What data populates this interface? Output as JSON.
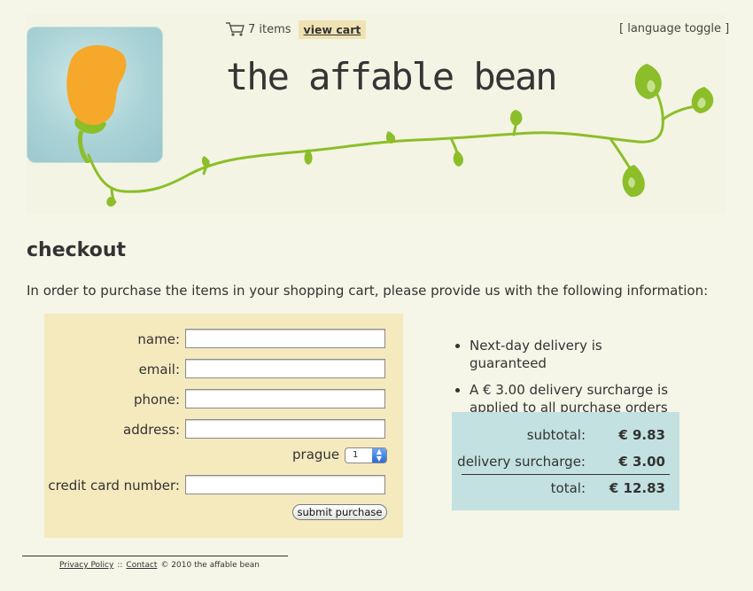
{
  "header": {
    "site_title": "the affable bean",
    "cart": {
      "item_count": "7 items",
      "view_cart_label": "view cart"
    },
    "language_toggle": "[ language toggle ]"
  },
  "checkout": {
    "heading": "checkout",
    "intro": "In order to purchase the items in your shopping cart, please provide us with the following information:",
    "form": {
      "name_label": "name:",
      "email_label": "email:",
      "phone_label": "phone:",
      "address_label": "address:",
      "city_label": "prague",
      "city_select_value": "1",
      "credit_card_label": "credit card number:",
      "submit_label": "submit purchase"
    },
    "info": [
      "Next-day delivery is guaranteed",
      "A € 3.00 delivery surcharge is applied to all purchase orders"
    ],
    "totals": {
      "subtotal_label": "subtotal:",
      "subtotal_value": "€ 9.83",
      "surcharge_label": "delivery surcharge:",
      "surcharge_value": "€ 3.00",
      "total_label": "total:",
      "total_value": "€ 12.83"
    }
  },
  "footer": {
    "privacy_policy": "Privacy Policy",
    "separator": "::",
    "contact": "Contact",
    "copyright": "©  2010 the affable bean"
  },
  "colors": {
    "page_bg": "#f5f5e8",
    "form_bg": "#f5e9be",
    "price_box_bg": "#c2e1e0",
    "view_cart_bg": "#efe3b4",
    "vine_green": "#8cbe2a",
    "bean_orange": "#f6a82a",
    "logo_bg": "#a9d2d6"
  },
  "icons": {
    "cart": "shopping-cart-icon",
    "logo": "bean-logo"
  }
}
